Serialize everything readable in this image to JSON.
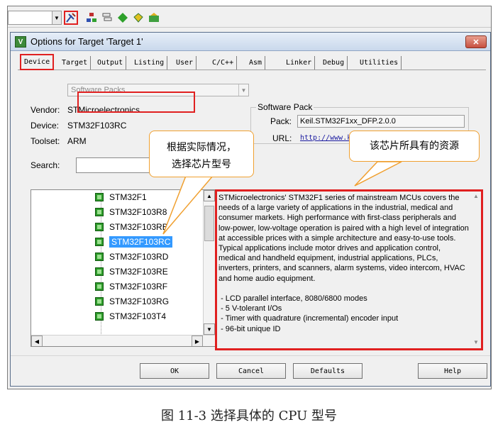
{
  "toolbar": {
    "icons": [
      "dropdown-arrow",
      "target-options-icon",
      "component-icon",
      "layers-icon",
      "green-diamond-icon",
      "pack-installer-icon",
      "manage-icon"
    ]
  },
  "dialog": {
    "title": "Options for Target 'Target 1'",
    "close_glyph": "✕",
    "tabs": [
      "Device",
      "Target",
      "Output",
      "Listing",
      "User",
      "C/C++",
      "Asm",
      "Linker",
      "Debug",
      "Utilities"
    ],
    "active_tab": "Device",
    "software_packs_combo": "Software Packs",
    "vendor_label": "Vendor:",
    "vendor_value": "STMicroelectronics",
    "device_label": "Device:",
    "device_value": "STM32F103RC",
    "toolset_label": "Toolset:",
    "toolset_value": "ARM",
    "search_label": "Search:",
    "search_value": "",
    "software_pack_group": "Software Pack",
    "pack_label": "Pack:",
    "pack_value": "Keil.STM32F1xx_DFP.2.0.0",
    "url_label": "URL:",
    "url_value": "http://www.k"
  },
  "device_tree": {
    "items": [
      "STM32F1",
      "STM32F103R8",
      "STM32F103RB",
      "STM32F103RC",
      "STM32F103RD",
      "STM32F103RE",
      "STM32F103RF",
      "STM32F103RG",
      "STM32F103T4"
    ],
    "selected": "STM32F103RC"
  },
  "description": "STMicroelectronics' STM32F1 series of mainstream MCUs covers the needs of a large variety of applications in the industrial, medical and consumer markets. High performance with first-class peripherals and low-power, low-voltage operation is paired with a high level of integration at accessible prices with a simple architecture and easy-to-use tools.\nTypical applications include motor drives and application control, medical and handheld equipment, industrial applications, PLCs, inverters, printers, and scanners, alarm systems, video intercom, HVAC and home audio equipment.\n\n - LCD parallel interface, 8080/6800 modes\n - 5 V-tolerant I/Os\n - Timer with quadrature (incremental) encoder input\n - 96-bit unique ID",
  "buttons": {
    "ok": "OK",
    "cancel": "Cancel",
    "defaults": "Defaults",
    "help": "Help"
  },
  "callouts": {
    "left_line1": "根据实际情况，",
    "left_line2": "选择芯片型号",
    "right": "该芯片所具有的资源"
  },
  "caption": "图 11-3 选择具体的 CPU 型号",
  "colors": {
    "highlight_red": "#e02020",
    "callout_border": "#f0a030",
    "selection_blue": "#3399ff"
  }
}
